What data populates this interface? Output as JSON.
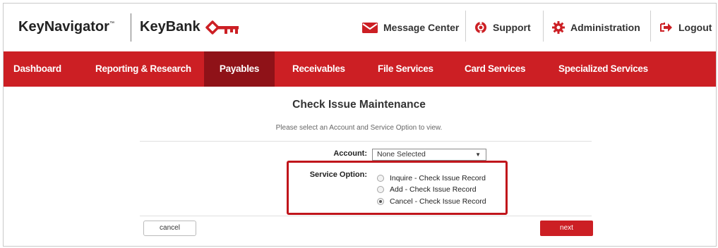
{
  "header": {
    "brand_navigator": "KeyNavigator",
    "brand_tm": "™",
    "brand_bank": "KeyBank",
    "utilities": {
      "message_center": "Message Center",
      "support": "Support",
      "administration": "Administration",
      "logout": "Logout"
    }
  },
  "nav": {
    "items": [
      {
        "label": "Dashboard"
      },
      {
        "label": "Reporting & Research"
      },
      {
        "label": "Payables",
        "active": true
      },
      {
        "label": "Receivables"
      },
      {
        "label": "File Services"
      },
      {
        "label": "Card Services"
      },
      {
        "label": "Specialized Services"
      }
    ]
  },
  "main": {
    "title": "Check Issue Maintenance",
    "instruction": "Please select an Account and Service Option to view.",
    "account_label": "Account:",
    "account_value": "None Selected",
    "service_label": "Service Option:",
    "service_options": [
      {
        "label": "Inquire - Check Issue Record",
        "checked": false
      },
      {
        "label": "Add - Check Issue Record",
        "checked": false
      },
      {
        "label": "Cancel - Check Issue Record",
        "checked": true
      }
    ],
    "cancel_label": "cancel",
    "next_label": "next"
  },
  "colors": {
    "brand_red": "#cc1f24",
    "nav_active": "#8f1218"
  },
  "icons": [
    "key-logo-icon",
    "envelope-icon",
    "lifebuoy-icon",
    "gear-icon",
    "logout-arrow-icon",
    "dropdown-arrow-icon"
  ]
}
